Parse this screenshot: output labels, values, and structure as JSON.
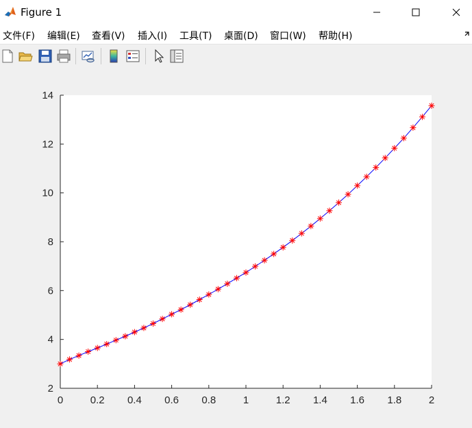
{
  "window": {
    "title": "Figure 1",
    "controls": [
      "minimize-icon",
      "maximize-icon",
      "close-icon"
    ]
  },
  "menubar": {
    "items": [
      {
        "label": "文件(F)"
      },
      {
        "label": "编辑(E)"
      },
      {
        "label": "查看(V)"
      },
      {
        "label": "插入(I)"
      },
      {
        "label": "工具(T)"
      },
      {
        "label": "桌面(D)"
      },
      {
        "label": "窗口(W)"
      },
      {
        "label": "帮助(H)"
      }
    ]
  },
  "toolbar": {
    "buttons": [
      {
        "icon": "new-figure-icon"
      },
      {
        "icon": "open-file-icon"
      },
      {
        "icon": "save-icon"
      },
      {
        "icon": "print-icon"
      },
      {
        "icon": "link-plot-icon"
      },
      {
        "icon": "insert-colorbar-icon"
      },
      {
        "icon": "insert-legend-icon"
      },
      {
        "icon": "edit-plot-icon"
      },
      {
        "icon": "property-inspector-icon"
      }
    ]
  },
  "colors": {
    "line": "#0000ff",
    "marker": "#ff0000",
    "axes_bg": "#ffffff",
    "figure_bg": "#f0f0f0"
  },
  "chart_data": {
    "type": "line",
    "title": "",
    "xlabel": "",
    "ylabel": "",
    "xlim": [
      0,
      2
    ],
    "ylim": [
      2,
      14
    ],
    "xticks": [
      0,
      0.2,
      0.4,
      0.6,
      0.8,
      1,
      1.2,
      1.4,
      1.6,
      1.8,
      2
    ],
    "xtick_labels": [
      "0",
      "0.2",
      "0.4",
      "0.6",
      "0.8",
      "1",
      "1.2",
      "1.4",
      "1.6",
      "1.8",
      "2"
    ],
    "yticks": [
      2,
      4,
      6,
      8,
      10,
      12,
      14
    ],
    "ytick_labels": [
      "2",
      "4",
      "6",
      "8",
      "10",
      "12",
      "14"
    ],
    "grid": false,
    "series": [
      {
        "line_color": "#0000ff",
        "marker": "asterisk",
        "marker_color": "#ff0000",
        "x": [
          0,
          0.05,
          0.1,
          0.15,
          0.2,
          0.25,
          0.3,
          0.35,
          0.4,
          0.45,
          0.5,
          0.55,
          0.6,
          0.65,
          0.7,
          0.75,
          0.8,
          0.85,
          0.9,
          0.95,
          1,
          1.05,
          1.1,
          1.15,
          1.2,
          1.25,
          1.3,
          1.35,
          1.4,
          1.45,
          1.5,
          1.55,
          1.6,
          1.65,
          1.7,
          1.75,
          1.8,
          1.85,
          1.9,
          1.95,
          2
        ],
        "y": [
          3.0,
          3.18,
          3.34,
          3.5,
          3.65,
          3.81,
          3.97,
          4.13,
          4.3,
          4.47,
          4.65,
          4.84,
          5.03,
          5.22,
          5.42,
          5.63,
          5.84,
          6.06,
          6.28,
          6.51,
          6.74,
          6.99,
          7.24,
          7.5,
          7.77,
          8.05,
          8.34,
          8.64,
          8.95,
          9.27,
          9.6,
          9.94,
          10.3,
          10.66,
          11.04,
          11.43,
          11.83,
          12.24,
          12.67,
          13.11,
          13.57
        ]
      }
    ]
  }
}
